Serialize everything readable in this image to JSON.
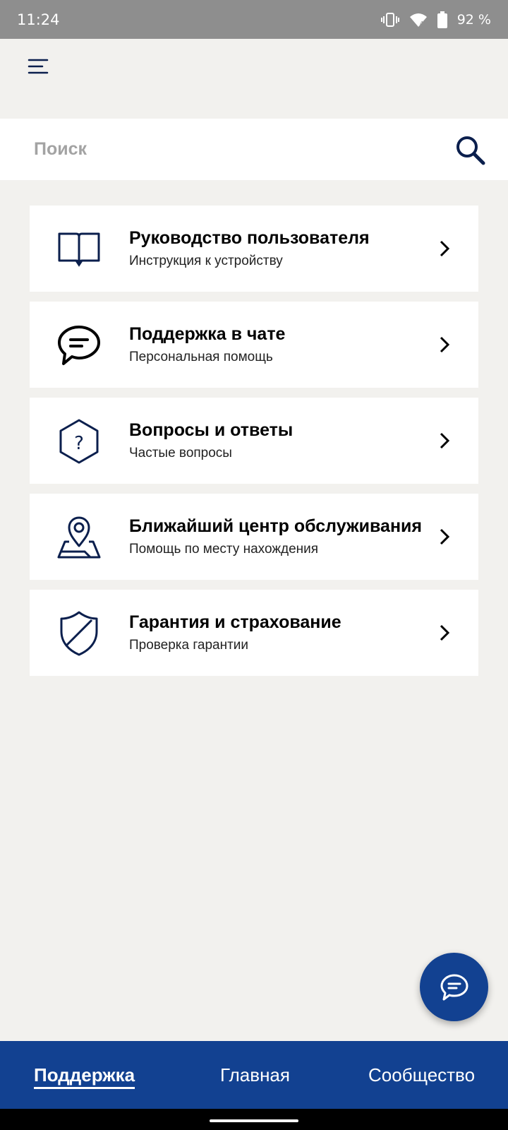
{
  "status_bar": {
    "time": "11:24",
    "battery": "92 %"
  },
  "search": {
    "placeholder": "Поиск",
    "value": ""
  },
  "cards": [
    {
      "title": "Руководство пользователя",
      "subtitle": "Инструкция к устройству",
      "icon": "book-icon"
    },
    {
      "title": "Поддержка в чате",
      "subtitle": "Персональная помощь",
      "icon": "chat-bubble-icon"
    },
    {
      "title": "Вопросы и ответы",
      "subtitle": "Частые вопросы",
      "icon": "question-hexagon-icon"
    },
    {
      "title": "Ближайший центр обслуживания",
      "subtitle": "Помощь по месту нахождения",
      "icon": "map-pin-icon"
    },
    {
      "title": "Гарантия и страхование",
      "subtitle": "Проверка гарантии",
      "icon": "shield-icon"
    }
  ],
  "bottom_nav": {
    "tabs": [
      {
        "label": "Поддержка",
        "active": true
      },
      {
        "label": "Главная",
        "active": false
      },
      {
        "label": "Сообщество",
        "active": false
      }
    ]
  },
  "colors": {
    "accent": "#124191",
    "icon_stroke": "#0b1f4d",
    "background": "#f2f1ee"
  }
}
